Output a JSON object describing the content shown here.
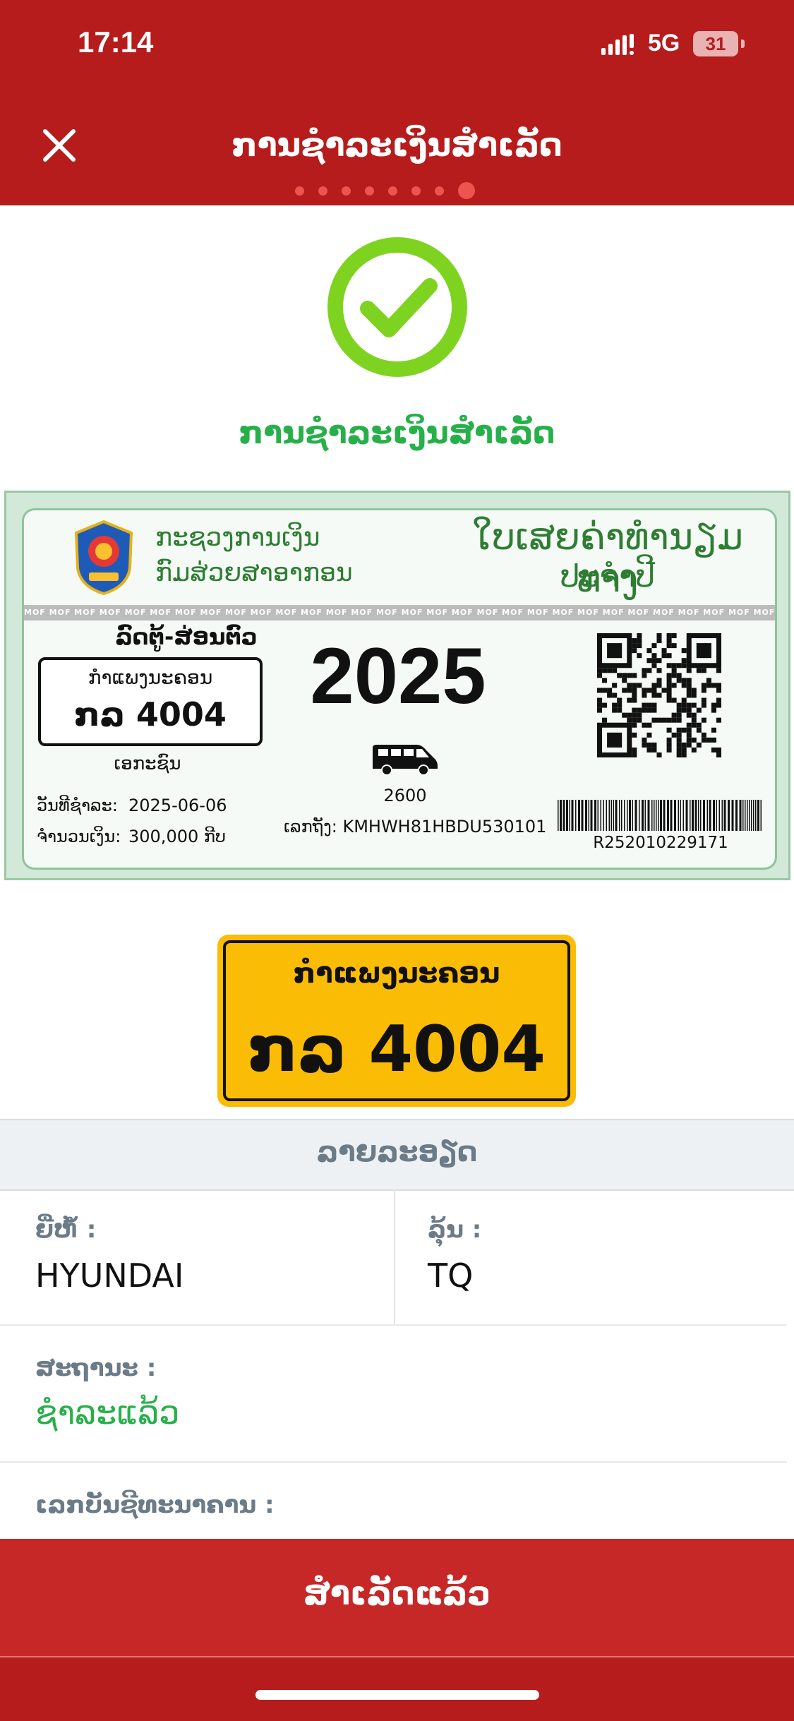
{
  "status_bar": {
    "time": "17:14",
    "network": "5G",
    "battery": "31"
  },
  "header": {
    "title": "ການຊຳລະເງິນສຳເລັດ",
    "close_icon": "close-icon",
    "progress_dots": 8,
    "active_dot": 8
  },
  "success": {
    "icon": "check-circle-icon",
    "message": "ການຊຳລະເງິນສຳເລັດ",
    "color": "#7ed321"
  },
  "certificate": {
    "org_line1": "ກະຊວງການເງິນ",
    "org_line2": "ກົມສ່ວຍສາອາກອນ",
    "doc_title_line1": "ໃບເສຍຄ່າທຳນຽມທາງ",
    "doc_title_line2": "ປະຈຳປີ",
    "band_text": "MOF",
    "vehicle_type": "ລົດຕູ້-ສ່ອນຕົວ",
    "plate_province": "ກຳແພງນະຄອນ",
    "plate_number": "ກລ 4004",
    "vehicle_use": "ເອກະຊົນ",
    "date_label": "ວັນທີຊຳລະ:",
    "date_value": "2025-06-06",
    "amount_label": "ຈຳນວນເງິນ:",
    "amount_value": "300,000 ກີບ",
    "year": "2025",
    "engine_cc": "2600",
    "chassis": "ເລກຖັງ: KMHWH81HBDU530101",
    "receipt_no": "R252010229171"
  },
  "plate": {
    "province": "ກຳແພງນະຄອນ",
    "number": "ກລ 4004",
    "color": "#fbbc05"
  },
  "details": {
    "section_title": "ລາຍລະອຽດ",
    "brand_label": "ຍີ່ຫໍ້ :",
    "brand_value": "HYUNDAI",
    "model_label": "ລຸ້ນ :",
    "model_value": "TQ",
    "status_label": "ສະຖານະ :",
    "status_value": "ຊຳລະແລ້ວ",
    "account_label": "ເລກບັນຊີທະນາຄານ :"
  },
  "cta": {
    "label": "ສຳເລັດແລ້ວ"
  },
  "colors": {
    "brand_red": "#b71c1c",
    "success_green": "#27b04a"
  }
}
